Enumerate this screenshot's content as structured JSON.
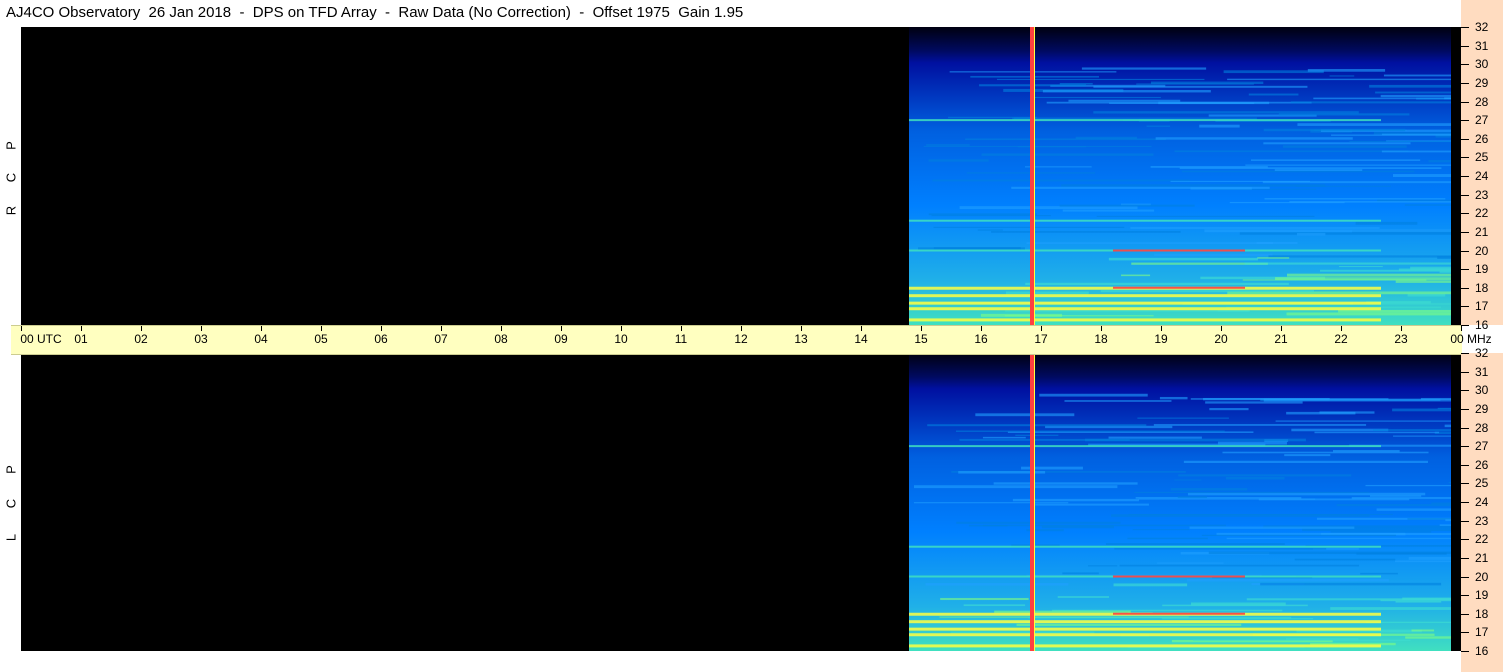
{
  "title": "AJ4CO Observatory  26 Jan 2018  -  DPS on TFD Array  -  Raw Data (No Correction)  -  Offset 1975  Gain 1.95",
  "chart_data": {
    "type": "heatmap",
    "panels": [
      {
        "name": "R C P",
        "side_label": [
          "R",
          "C",
          "P"
        ]
      },
      {
        "name": "L C P",
        "side_label": [
          "L",
          "C",
          "P"
        ]
      }
    ],
    "x_axis": {
      "labels": [
        "00 UTC",
        "01",
        "02",
        "03",
        "04",
        "05",
        "06",
        "07",
        "08",
        "09",
        "10",
        "11",
        "12",
        "13",
        "14",
        "15",
        "16",
        "17",
        "18",
        "19",
        "20",
        "21",
        "22",
        "23",
        "00 MHz"
      ],
      "range": [
        0,
        24
      ],
      "unit": "UTC"
    },
    "y_axis": {
      "labels": [
        "16",
        "17",
        "18",
        "19",
        "20",
        "21",
        "22",
        "23",
        "24",
        "25",
        "26",
        "27",
        "28",
        "29",
        "30",
        "31",
        "32"
      ],
      "range": [
        16,
        32
      ],
      "unit": "MHz"
    },
    "data_start_hour": 14.8,
    "data_end_hour": 24,
    "interference_line_hour": 16.85,
    "emission_bands_mhz": [
      16.3,
      16.9,
      17.2,
      17.6,
      18.0,
      20.0,
      21.6,
      27.0
    ],
    "colors": {
      "background": "#000000",
      "low": "#0010a0",
      "mid": "#0080ff",
      "high": "#40e0c0",
      "peak": "#ffff40",
      "interference": "#ff4040",
      "time_axis_bg": "#ffffc0",
      "freq_axis_bg": "#ffdcc0"
    }
  }
}
